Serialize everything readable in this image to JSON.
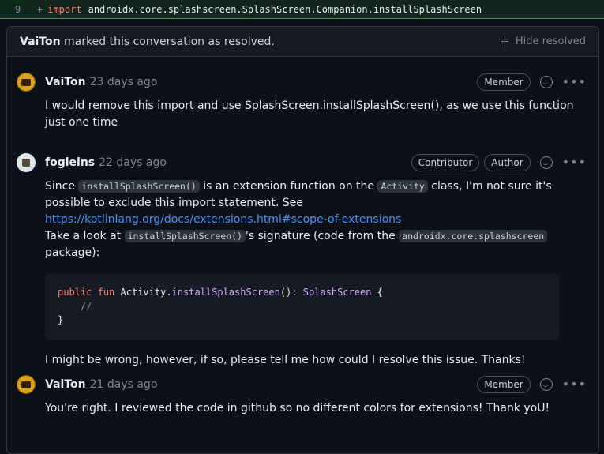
{
  "diff": {
    "line_number": "9",
    "plus": "+",
    "keyword": "import",
    "code": "androidx.core.splashscreen.SplashScreen.Companion.installSplashScreen"
  },
  "thread": {
    "resolved_user": "VaiTon",
    "resolved_text": "marked this conversation as resolved.",
    "hide_resolved": "Hide resolved"
  },
  "comments": [
    {
      "author": "VaiTon",
      "time": "23 days ago",
      "badges": [
        "Member"
      ],
      "text": "I would remove this import and use SplashScreen.installSplashScreen(), as we use this function just one time"
    },
    {
      "author": "fogleins",
      "time": "22 days ago",
      "badges": [
        "Contributor",
        "Author"
      ],
      "p1": {
        "t1": "Since ",
        "c1": "installSplashScreen()",
        "t2": " is an extension function on the ",
        "c2": "Activity",
        "t3": " class, I'm not sure it's possible to exclude this import statement. See ",
        "link": "https://kotlinlang.org/docs/extensions.html#scope-of-extensions"
      },
      "p2": {
        "t1": "Take a look at ",
        "c1": "installSplashScreen()",
        "t2": "'s signature (code from the ",
        "c2": "androidx.core.splashscreen",
        "t3": " package):"
      },
      "code": {
        "kw1": "public",
        "kw2": "fun",
        "recv": "Activity.",
        "fn": "installSplashScreen",
        "sig": "(): ",
        "ret": "SplashScreen",
        "open": " {",
        "comment": "//",
        "close": "}"
      },
      "p3": "I might be wrong, however, if so, please tell me how could I resolve this issue. Thanks!"
    },
    {
      "author": "VaiTon",
      "time": "21 days ago",
      "badges": [
        "Member"
      ],
      "text": "You're right. I reviewed the code in github so no different colors for extensions! Thank yoU!"
    }
  ]
}
